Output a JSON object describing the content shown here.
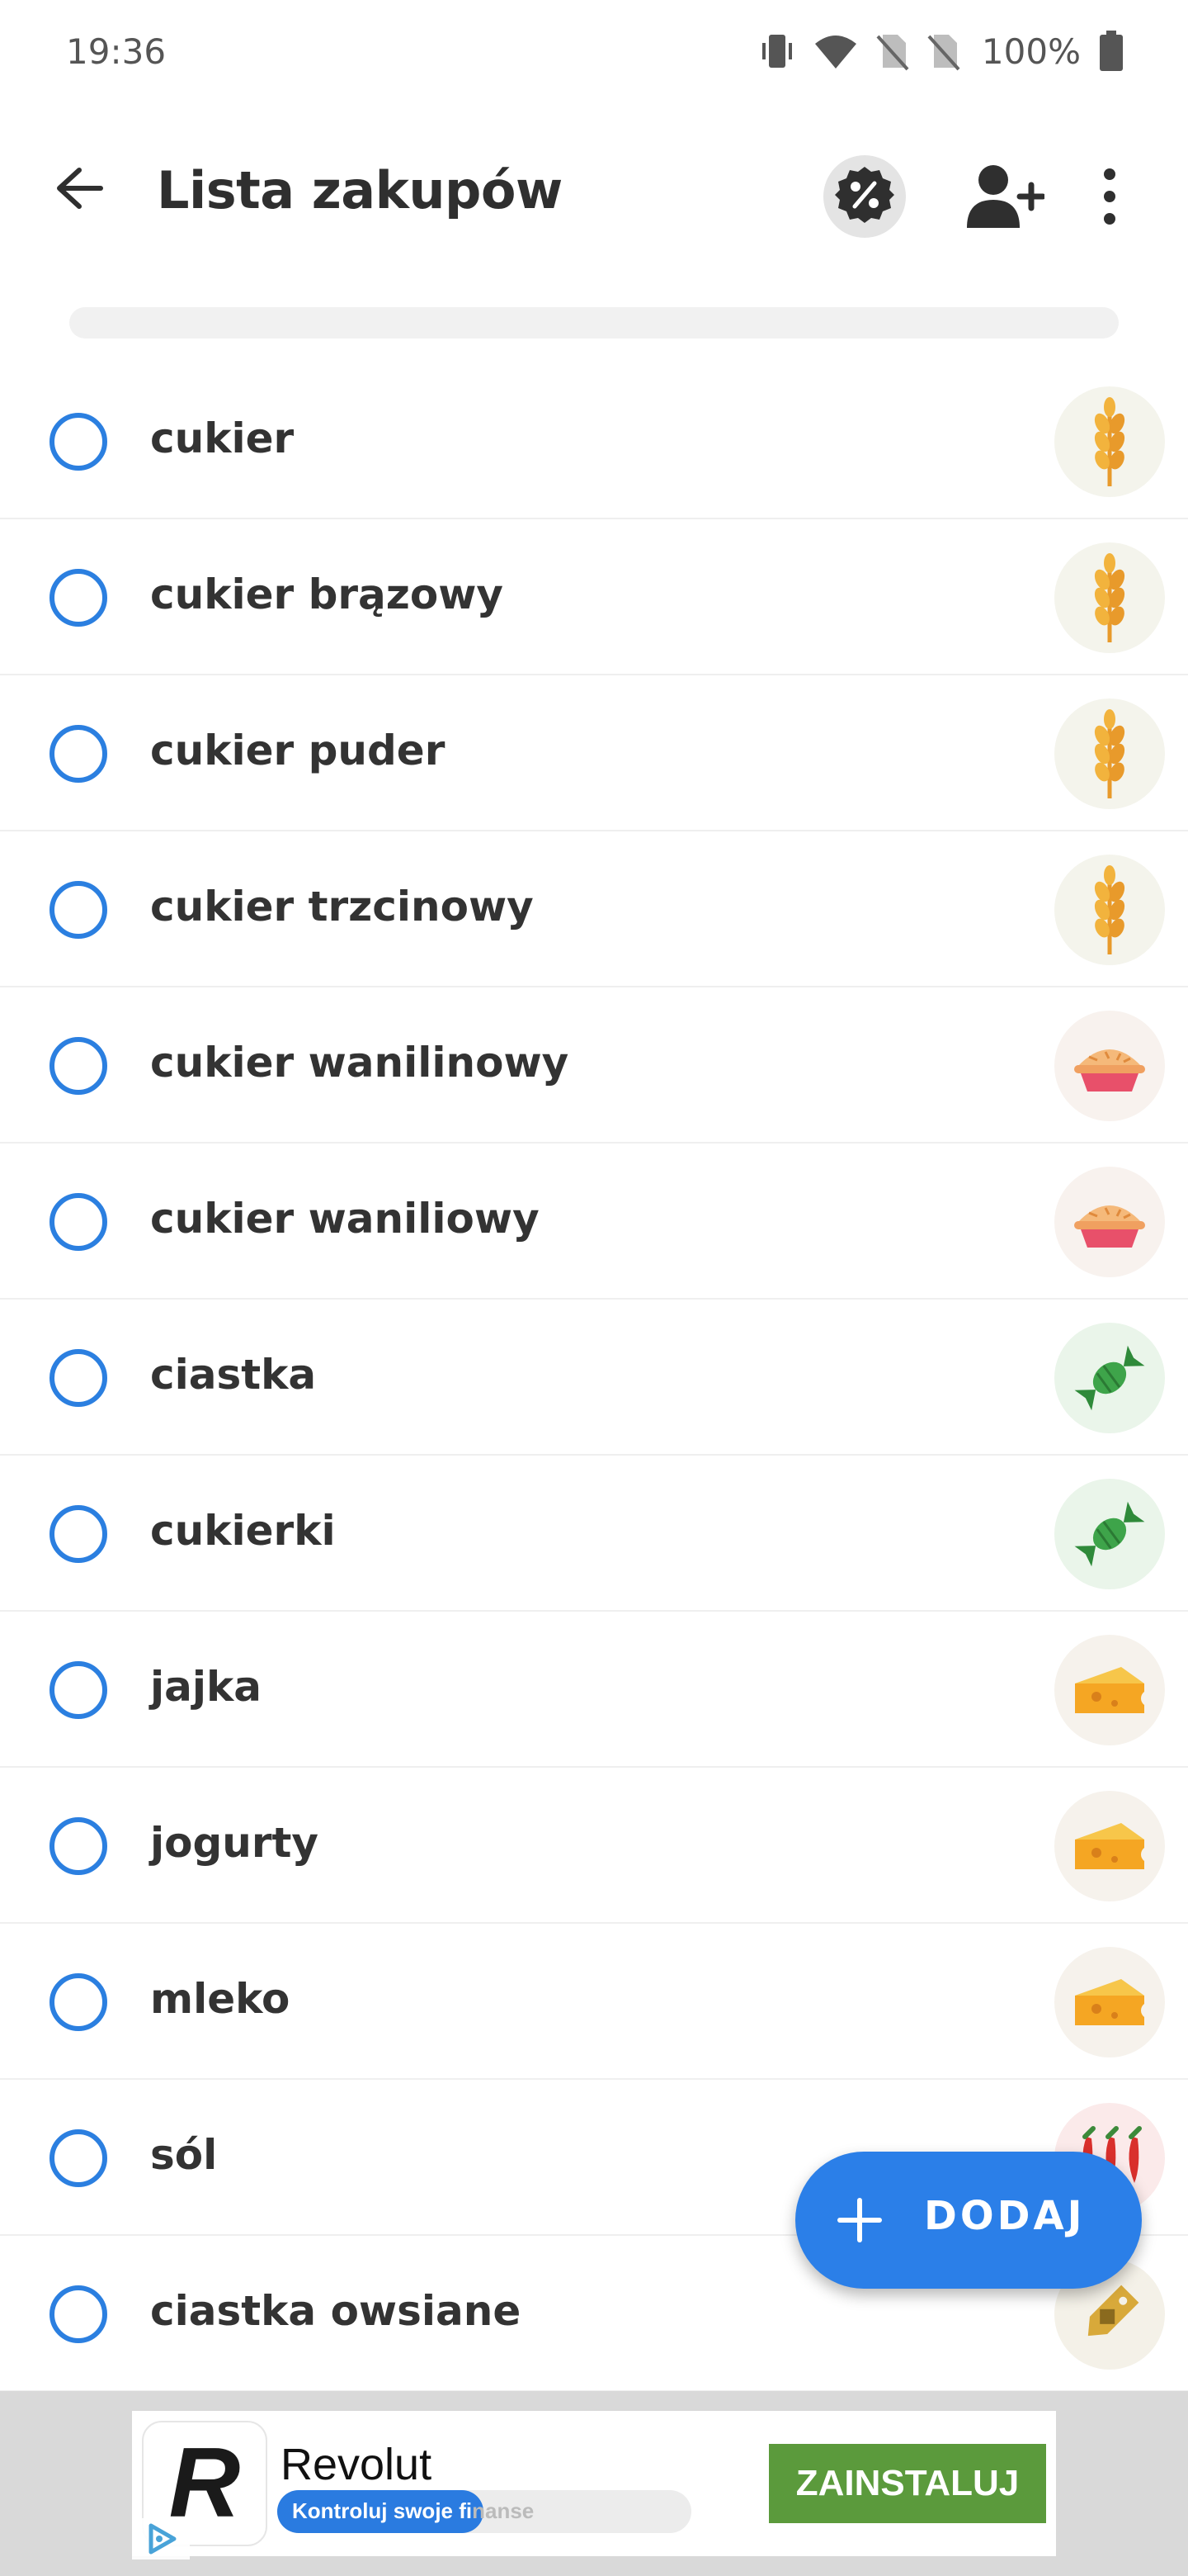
{
  "status_bar": {
    "time": "19:36",
    "battery": "100%",
    "icons": [
      "vibrate-icon",
      "wifi-icon",
      "no-sim-icon",
      "no-sim-icon",
      "battery-icon"
    ]
  },
  "app_bar": {
    "title": "Lista zakupów",
    "back_icon": "arrow-left-icon",
    "promo_icon": "percent-badge-icon",
    "add_user_icon": "add-user-icon",
    "more_icon": "more-vertical-icon"
  },
  "items": [
    {
      "label": "cukier",
      "category_icon": "wheat-icon"
    },
    {
      "label": "cukier brązowy",
      "category_icon": "wheat-icon"
    },
    {
      "label": "cukier puder",
      "category_icon": "wheat-icon"
    },
    {
      "label": "cukier trzcinowy",
      "category_icon": "wheat-icon"
    },
    {
      "label": "cukier wanilinowy",
      "category_icon": "pie-icon"
    },
    {
      "label": "cukier waniliowy",
      "category_icon": "pie-icon"
    },
    {
      "label": "ciastka",
      "category_icon": "candy-icon"
    },
    {
      "label": "cukierki",
      "category_icon": "candy-icon"
    },
    {
      "label": "jajka",
      "category_icon": "cheese-icon"
    },
    {
      "label": "jogurty",
      "category_icon": "cheese-icon"
    },
    {
      "label": "mleko",
      "category_icon": "cheese-icon"
    },
    {
      "label": "sól",
      "category_icon": "chili-icon"
    },
    {
      "label": "ciastka owsiane",
      "category_icon": "tag-icon"
    }
  ],
  "fab": {
    "label": "DODAJ",
    "icon": "plus-icon"
  },
  "ad": {
    "title": "Revolut",
    "subtitle": "Kontroluj swoje fi",
    "subtitle_tail": "nanse",
    "install_label": "ZAINSTALUJ",
    "logo_letter": "R",
    "choice_icon": "ad-choices-icon"
  },
  "colors": {
    "accent": "#2b7fe0",
    "fab": "#2b7fe8",
    "install_button": "#5b9a3c"
  }
}
